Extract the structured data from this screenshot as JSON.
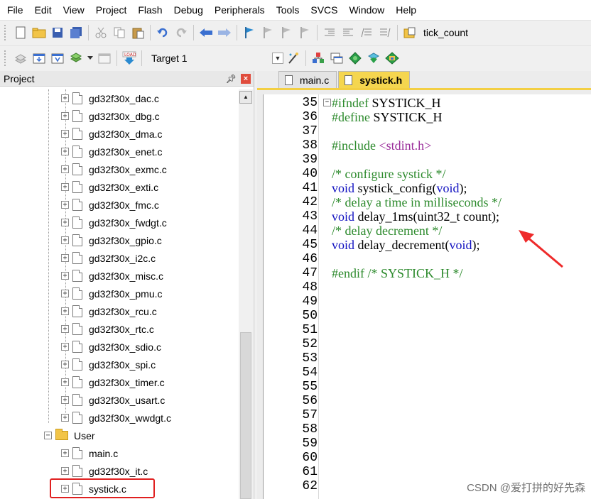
{
  "menu": [
    "File",
    "Edit",
    "View",
    "Project",
    "Flash",
    "Debug",
    "Peripherals",
    "Tools",
    "SVCS",
    "Window",
    "Help"
  ],
  "toolbar1": {
    "find_label": "tick_count"
  },
  "toolbar2": {
    "target": "Target 1"
  },
  "project": {
    "title": "Project",
    "files_above": [
      "gd32f30x_dac.c",
      "gd32f30x_dbg.c",
      "gd32f30x_dma.c",
      "gd32f30x_enet.c",
      "gd32f30x_exmc.c",
      "gd32f30x_exti.c",
      "gd32f30x_fmc.c",
      "gd32f30x_fwdgt.c",
      "gd32f30x_gpio.c",
      "gd32f30x_i2c.c",
      "gd32f30x_misc.c",
      "gd32f30x_pmu.c",
      "gd32f30x_rcu.c",
      "gd32f30x_rtc.c",
      "gd32f30x_sdio.c",
      "gd32f30x_spi.c",
      "gd32f30x_timer.c",
      "gd32f30x_usart.c",
      "gd32f30x_wwdgt.c"
    ],
    "group": "User",
    "group_files": [
      "main.c",
      "gd32f30x_it.c",
      "systick.c"
    ]
  },
  "tabs": [
    {
      "label": "main.c",
      "active": false
    },
    {
      "label": "systick.h",
      "active": true
    }
  ],
  "code": {
    "lines": [
      {
        "n": "35",
        "fold": "−",
        "segs": [
          {
            "c": "pp",
            "t": "#ifndef "
          },
          {
            "c": "fn",
            "t": "SYSTICK_H"
          }
        ]
      },
      {
        "n": "36",
        "segs": [
          {
            "c": "pp",
            "t": "#define "
          },
          {
            "c": "fn",
            "t": "SYSTICK_H"
          }
        ]
      },
      {
        "n": "37",
        "segs": []
      },
      {
        "n": "38",
        "segs": [
          {
            "c": "pp",
            "t": "#include "
          },
          {
            "c": "str",
            "t": "<stdint.h>"
          }
        ]
      },
      {
        "n": "39",
        "segs": []
      },
      {
        "n": "40",
        "segs": [
          {
            "c": "cm",
            "t": "/* configure systick */"
          }
        ]
      },
      {
        "n": "41",
        "segs": [
          {
            "c": "kw",
            "t": "void "
          },
          {
            "c": "fn",
            "t": "systick_config("
          },
          {
            "c": "kw",
            "t": "void"
          },
          {
            "c": "fn",
            "t": ");"
          }
        ]
      },
      {
        "n": "42",
        "segs": [
          {
            "c": "cm",
            "t": "/* delay a time in milliseconds */"
          }
        ]
      },
      {
        "n": "43",
        "segs": [
          {
            "c": "kw",
            "t": "void "
          },
          {
            "c": "fn",
            "t": "delay_1ms(uint32_t count);"
          }
        ]
      },
      {
        "n": "44",
        "segs": [
          {
            "c": "cm",
            "t": "/* delay decrement */"
          }
        ]
      },
      {
        "n": "45",
        "segs": [
          {
            "c": "kw",
            "t": "void "
          },
          {
            "c": "fn",
            "t": "delay_decrement("
          },
          {
            "c": "kw",
            "t": "void"
          },
          {
            "c": "fn",
            "t": ");"
          }
        ]
      },
      {
        "n": "46",
        "segs": []
      },
      {
        "n": "47",
        "segs": [
          {
            "c": "pp",
            "t": "#endif /* SYSTICK_H */"
          }
        ]
      },
      {
        "n": "48",
        "segs": []
      },
      {
        "n": "49",
        "segs": []
      },
      {
        "n": "50",
        "segs": []
      },
      {
        "n": "51",
        "segs": []
      },
      {
        "n": "52",
        "segs": []
      },
      {
        "n": "53",
        "segs": []
      },
      {
        "n": "54",
        "segs": []
      },
      {
        "n": "55",
        "segs": []
      },
      {
        "n": "56",
        "segs": []
      },
      {
        "n": "57",
        "segs": []
      },
      {
        "n": "58",
        "segs": []
      },
      {
        "n": "59",
        "segs": []
      },
      {
        "n": "60",
        "segs": []
      },
      {
        "n": "61",
        "segs": []
      },
      {
        "n": "62",
        "segs": []
      }
    ]
  },
  "watermark": "CSDN @爱打拼的好先森",
  "colors": {
    "tab_active": "#f5d64f",
    "keyword": "#1010c0",
    "comment": "#2c8a2c",
    "highlight": "#e02020"
  }
}
